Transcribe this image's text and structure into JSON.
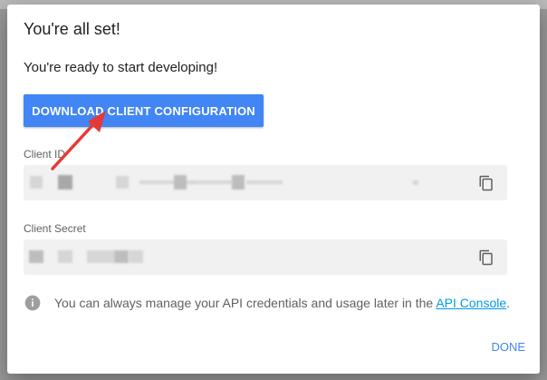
{
  "dialog": {
    "title": "You're all set!",
    "subtitle": "You're ready to start developing!",
    "download_label": "DOWNLOAD CLIENT CONFIGURATION",
    "client_id_label": "Client ID",
    "client_secret_label": "Client Secret",
    "info_text": "You can always manage your API credentials and usage later in the ",
    "info_link": "API Console",
    "info_suffix": ".",
    "done_label": "DONE"
  },
  "colors": {
    "accent": "#4285f4",
    "link": "#039be5",
    "annotation_arrow": "#e53935"
  },
  "icons": {
    "copy": "copy-icon",
    "info": "info-icon"
  }
}
